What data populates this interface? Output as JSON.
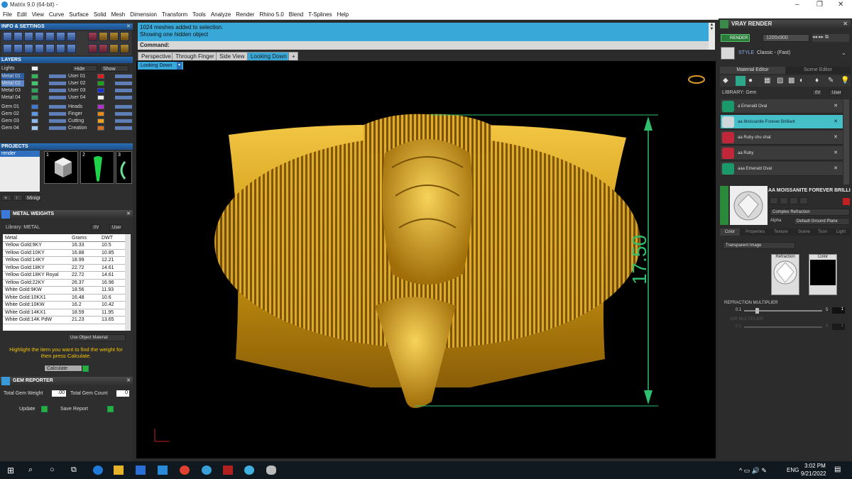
{
  "window": {
    "title": "Matrix 9.0 (64-bit) -",
    "controls": [
      "–",
      "❐",
      "✕"
    ]
  },
  "menu": [
    "File",
    "Edit",
    "View",
    "Curve",
    "Surface",
    "Solid",
    "Mesh",
    "Dimension",
    "Transform",
    "Tools",
    "Analyze",
    "Render",
    "Rhino 5.0",
    "Blend",
    "T-Splines",
    "Help"
  ],
  "left": {
    "info_title": "INFO & SETTINGS",
    "layers_title": "LAYERS",
    "lights_label": "Lights",
    "hide_label": "Hide",
    "show_label": "Show",
    "metal_layers": [
      "Metal 01",
      "Metal 02",
      "Metal 03",
      "Metal 04"
    ],
    "user_layers": [
      "User 01",
      "User 02",
      "User 03",
      "User 04"
    ],
    "gem_layers": [
      "Gem 01",
      "Gem 02",
      "Gem 03",
      "Gem 04"
    ],
    "misc_layers": [
      "Heads",
      "Finger",
      "Cutting",
      "Creation"
    ],
    "metal_colors": [
      "#2fb85a",
      "#3ccb6b",
      "#2aa85a",
      "#2e9e5a"
    ],
    "user_colors": [
      "#d92020",
      "#1aa51a",
      "#1a2ed9",
      "#f0f0f0"
    ],
    "gem_colors": [
      "#3a7ad8",
      "#5a9ae8",
      "#8ab8f0",
      "#a0c8f5"
    ],
    "misc_colors": [
      "#b030d0",
      "#e88a1a",
      "#f0a020",
      "#d07020"
    ],
    "projects_title": "PROJECTS",
    "project_item": "render",
    "thumbs": [
      "1",
      "2",
      "3"
    ],
    "minigr": "Minigr",
    "metal_weights_title": "METAL WEIGHTS",
    "library_label": "Library: METAL",
    "lib_btns": [
      "0V",
      "User"
    ],
    "table_headers": [
      "Metal",
      "Grams",
      "DWT"
    ],
    "table_rows": [
      [
        "Yellow Gold:9KY",
        "16.33",
        "10.5"
      ],
      [
        "Yellow Gold:10KY",
        "16.88",
        "10.85"
      ],
      [
        "Yellow Gold:14KY",
        "18.99",
        "12.21"
      ],
      [
        "Yellow Gold:18KY",
        "22.72",
        "14.61"
      ],
      [
        "Yellow Gold:18KY Royal",
        "22.72",
        "14.61"
      ],
      [
        "Yellow Gold:22KY",
        "26.37",
        "16.96"
      ],
      [
        "White Gold:9KW",
        "18.56",
        "11.93"
      ],
      [
        "White Gold:10KX1",
        "16.48",
        "10.6"
      ],
      [
        "White Gold:10KW",
        "16.2",
        "10.42"
      ],
      [
        "White Gold:14KX1",
        "18.59",
        "11.95"
      ],
      [
        "White Gold:14K PdW",
        "21.23",
        "13.65"
      ]
    ],
    "use_object_material": "Use Object Material",
    "highlight_text": "Highlight the item you want to find the weight for then press Calculate.",
    "calculate": "Calculate",
    "gem_reporter_title": "GEM REPORTER",
    "total_gem_weight_label": "Total Gem Weight",
    "total_gem_weight": ".00",
    "total_gem_count_label": "Total Gem Count",
    "total_gem_count": "0",
    "update": "Update",
    "save_report": "Save Report"
  },
  "center": {
    "messages": [
      "1024 meshes added to selection.",
      "Showing one hidden object"
    ],
    "command_label": "Command:",
    "tabs": [
      "Perspective",
      "Through Finger",
      "Side View",
      "Looking Down"
    ],
    "active_tab": "Looking Down",
    "view_select": "Looking Down",
    "dimension": "17.50",
    "accent": "#37a8d8",
    "dim_color": "#2fbf6f",
    "gold": "#d6a317"
  },
  "right": {
    "vray_title": "VRAY RENDER",
    "render_btn": "RENDER",
    "resolution": "1200x900",
    "style_label": "STYLE",
    "style_value": "Classic - (Fast)",
    "tab_material": "Material Editor",
    "tab_scene": "Scene Editor",
    "library_label": "LIBRARY: Gem",
    "lib_btns": [
      "0V",
      "User"
    ],
    "library_items": [
      {
        "name": "a Emerald Oval",
        "color": "#1a9a6a"
      },
      {
        "name": "aa Moissanite Forever Brilliant",
        "color": "#cfd6da"
      },
      {
        "name": "aa Ruby chu shat",
        "color": "#c0283a"
      },
      {
        "name": "aa Ruby",
        "color": "#c0283a"
      },
      {
        "name": "aaa Emerald Oval",
        "color": "#1a9a6a"
      }
    ],
    "selected_item": "AA MOISSANITE FOREVER BRILLIANT",
    "complex_refraction": "Complex Refraction",
    "alpha_label": "Alpha",
    "ground_plane": "Default Ground Plane",
    "sub_tabs": [
      "Color",
      "Properties",
      "Texture",
      "Scene",
      "Toon",
      "Light"
    ],
    "transparent": "Transparent Image",
    "refraction_label": "Refraction",
    "color_label": "Color",
    "refraction_multiplier": "REFRACTION MULTIPLIER",
    "rm_min": "0.1",
    "rm_max": "5",
    "rm_value": "1",
    "ior_multiplier": "IOR MULTIPLIER",
    "ior_min": "0.1",
    "ior_max": "5",
    "ior_value": "1"
  },
  "taskbar": {
    "lang": "ENG",
    "time": "3:02 PM",
    "date": "9/21/2022"
  }
}
